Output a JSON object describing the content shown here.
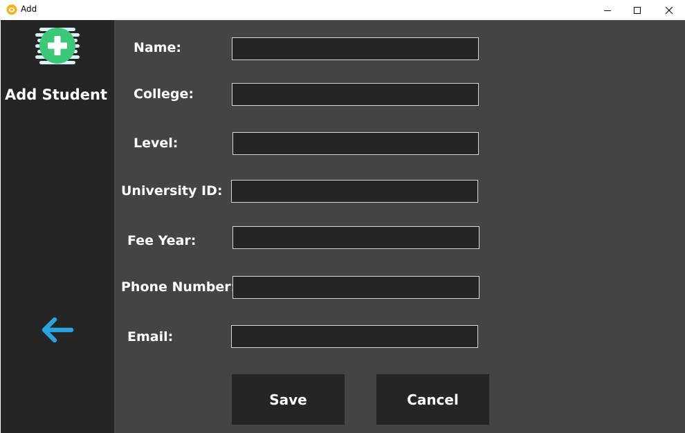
{
  "window": {
    "title": "Add"
  },
  "sidebar": {
    "title": "Add Student",
    "logo_icon": "add-circle-icon",
    "back_icon": "arrow-left-icon"
  },
  "form": {
    "name_label": "Name:",
    "college_label": "College:",
    "level_label": "Level:",
    "university_id_label": "University ID:",
    "fee_year_label": "Fee Year:",
    "phone_label": "Phone Number:",
    "email_label": "Email:",
    "name_value": "",
    "college_value": "",
    "level_value": "",
    "university_id_value": "",
    "fee_year_value": "",
    "phone_value": "",
    "email_value": ""
  },
  "actions": {
    "save_label": "Save",
    "cancel_label": "Cancel"
  },
  "colors": {
    "sidebar_bg": "#252525",
    "main_bg": "#444444",
    "input_bg": "#252525",
    "accent_green": "#3cc878",
    "accent_blue": "#2aa3df"
  }
}
